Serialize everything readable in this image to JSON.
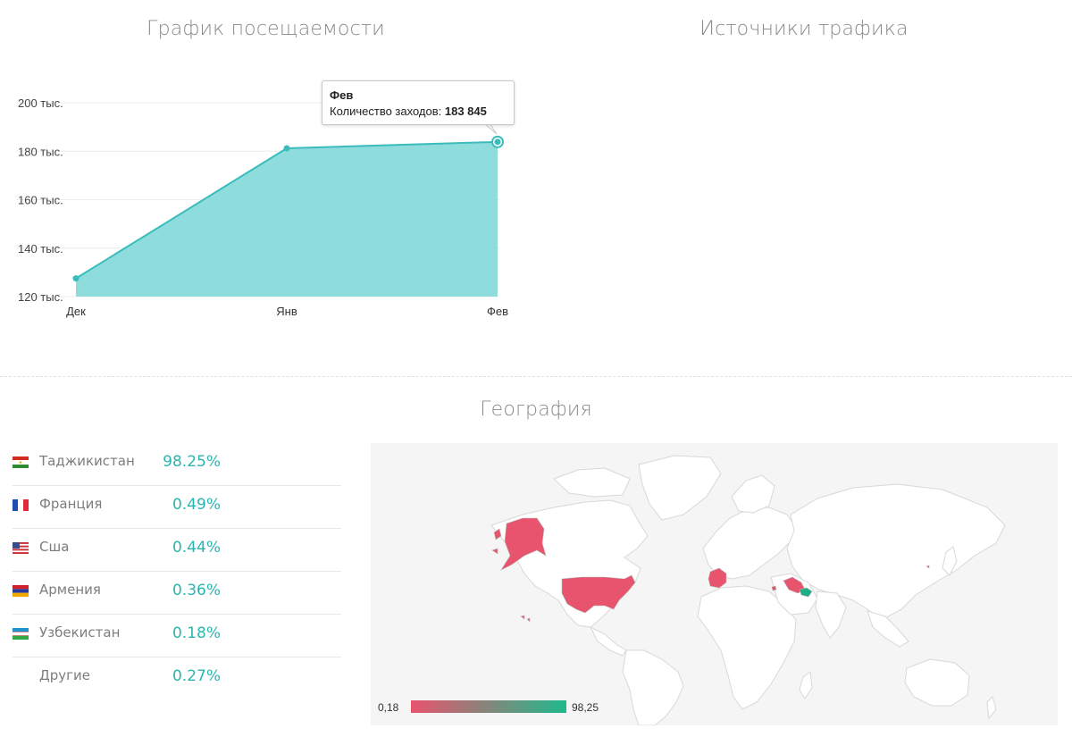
{
  "visits": {
    "title": "График посещаемости",
    "tooltip": {
      "title": "Фев",
      "label": "Количество заходов:",
      "value": "183 845"
    }
  },
  "sources": {
    "title": "Источники трафика"
  },
  "geography": {
    "title": "География",
    "countries": [
      {
        "name": "Таджикистан",
        "percent": "98.25%",
        "flag": "flag-tajikistan-icon"
      },
      {
        "name": "Франция",
        "percent": "0.49%",
        "flag": "flag-france-icon"
      },
      {
        "name": "Сша",
        "percent": "0.44%",
        "flag": "flag-usa-icon"
      },
      {
        "name": "Армения",
        "percent": "0.36%",
        "flag": "flag-armenia-icon"
      },
      {
        "name": "Узбекистан",
        "percent": "0.18%",
        "flag": "flag-uzbekistan-icon"
      },
      {
        "name": "Другие",
        "percent": "0.27%",
        "flag": ""
      }
    ],
    "legend": {
      "min": "0,18",
      "max": "98,25",
      "min_color": "#e8546e",
      "max_color": "#1fb98a"
    }
  },
  "colors": {
    "accent": "#2bb5b0",
    "area_fill": "#8fdcdc",
    "line": "#3bbcbc",
    "highlight": "#e8546e",
    "highlight_max": "#1fae86"
  },
  "chart_data": {
    "type": "area",
    "categories": [
      "Дек",
      "Янв",
      "Фев"
    ],
    "series": [
      {
        "values": [
          127500,
          181200,
          183845
        ]
      }
    ],
    "ylim": [
      120000,
      200000
    ],
    "yticks": [
      {
        "value": 200000,
        "label": "200 тыс."
      },
      {
        "value": 180000,
        "label": "180 тыс."
      },
      {
        "value": 160000,
        "label": "160 тыс."
      },
      {
        "value": 140000,
        "label": "140 тыс."
      },
      {
        "value": 120000,
        "label": "120 тыс."
      }
    ],
    "grid": true,
    "highlighted_point": 2
  }
}
